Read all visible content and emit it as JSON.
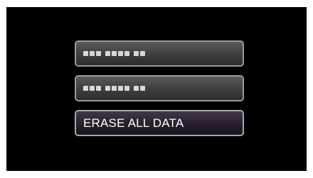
{
  "menu": {
    "items": [
      {
        "kind": "placeholder",
        "groups": [
          3,
          4,
          2
        ]
      },
      {
        "kind": "placeholder",
        "groups": [
          3,
          4,
          2
        ]
      },
      {
        "kind": "text",
        "label": "ERASE ALL DATA"
      }
    ]
  }
}
